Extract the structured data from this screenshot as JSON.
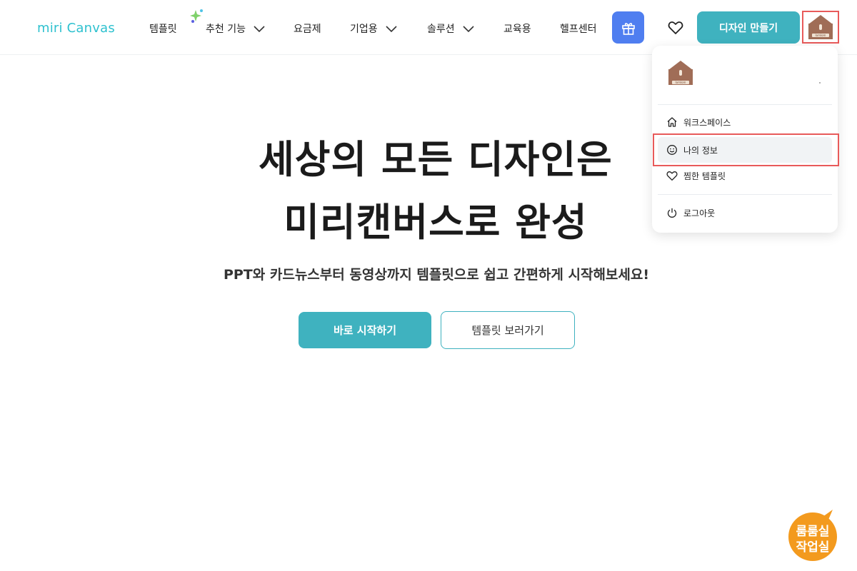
{
  "header": {
    "logo": "miri Canvas",
    "nav": [
      {
        "label": "템플릿",
        "has_chevron": false
      },
      {
        "label": "추천 기능",
        "has_chevron": true
      },
      {
        "label": "요금제",
        "has_chevron": false
      },
      {
        "label": "기업용",
        "has_chevron": true
      },
      {
        "label": "솔루션",
        "has_chevron": true
      },
      {
        "label": "교육용",
        "has_chevron": false
      },
      {
        "label": "헬프센터",
        "has_chevron": false
      }
    ],
    "make_design_label": "디자인 만들기",
    "gift_icon": "gift-icon",
    "heart_icon": "heart-icon"
  },
  "avatar": {
    "brand_text": "lomlom"
  },
  "dropdown": {
    "items": [
      {
        "label": "워크스페이스",
        "icon": "home-icon"
      },
      {
        "label": "나의 정보",
        "icon": "smile-icon",
        "active": true
      },
      {
        "label": "찜한 템플릿",
        "icon": "heart-icon"
      },
      {
        "label": "로그아웃",
        "icon": "power-icon"
      }
    ]
  },
  "hero": {
    "title_line1": "세상의 모든 디자인은",
    "title_line2": "미리캔버스로 완성",
    "subtitle": "PPT와 카드뉴스부터 동영상까지 템플릿으로 쉽고 간편하게 시작해보세요!",
    "primary_button": "바로 시작하기",
    "secondary_button": "템플릿 보러가기"
  },
  "watermark": {
    "line1": "룸룸실",
    "line2": "작업실"
  },
  "colors": {
    "accent": "#3fb2bf",
    "logo": "#2ec1cf",
    "gift": "#4f7ef0",
    "highlight": "#e85a5a",
    "avatar": "#a06d57",
    "watermark": "#f39a1e"
  }
}
